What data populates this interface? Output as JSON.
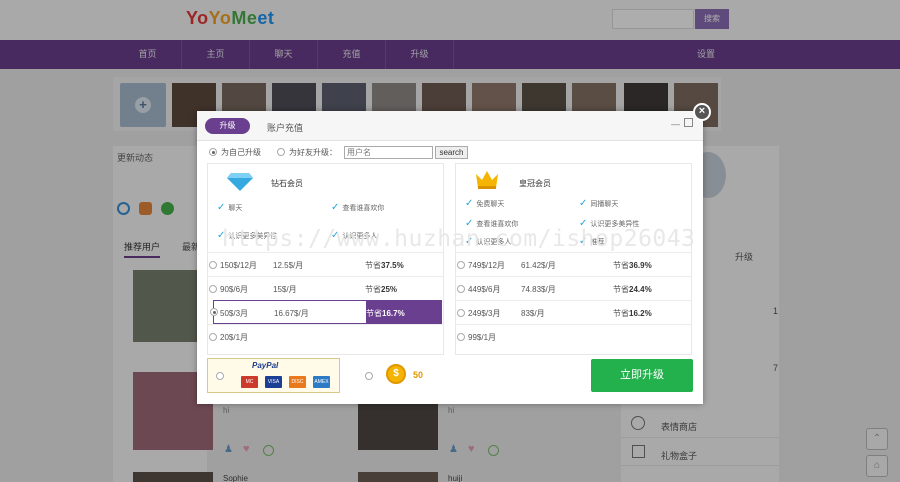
{
  "header": {
    "logo": {
      "p1": "Yo",
      "p2": "Yo",
      "p3": "Me",
      "p4": "et"
    },
    "search_button": "搜索"
  },
  "nav": {
    "items": [
      "首页",
      "主页",
      "聊天",
      "充值",
      "升级"
    ],
    "settings": "设置"
  },
  "feed": {
    "title": "更新动态"
  },
  "recommend_tabs": [
    "推荐用户",
    "最新"
  ],
  "cards": [
    {
      "text": "hi"
    },
    {
      "text": "hi"
    },
    {
      "name_partial": "Sophie"
    },
    {
      "name_partial": "huiji"
    }
  ],
  "right_sidebar": {
    "upgrade_label": "升级",
    "count_1": "1",
    "count_2": "7",
    "shop": "表情商店",
    "gift_box": "礼物盒子"
  },
  "modal": {
    "tabs": {
      "active": "升级",
      "inactive": "账户充值"
    },
    "options": {
      "self": "为自己升级",
      "friend": "为好友升级："
    },
    "username_placeholder": "用户名",
    "search_label": "search",
    "diamond": {
      "title": "钻石会员",
      "features": [
        "聊天",
        "查看谁喜欢你",
        "认识更多美异性",
        "认识更多人"
      ],
      "plans": [
        {
          "duration": "150$/12月",
          "monthly": "12.5$/月",
          "save_prefix": "节省",
          "save": "37.5%"
        },
        {
          "duration": "90$/6月",
          "monthly": "15$/月",
          "save_prefix": "节省",
          "save": "25%"
        },
        {
          "duration": "50$/3月",
          "monthly": "16.67$/月",
          "save_prefix": "节省",
          "save": "16.7%"
        },
        {
          "duration": "20$/1月",
          "monthly": "",
          "save_prefix": "",
          "save": ""
        }
      ]
    },
    "crown": {
      "title": "皇冠会员",
      "features": [
        "免费聊天",
        "同播聊天",
        "查看谁喜欢你",
        "认识更多美异性",
        "认识更多人",
        "推荐"
      ],
      "plans": [
        {
          "duration": "749$/12月",
          "monthly": "61.42$/月",
          "save_prefix": "节省",
          "save": "36.9%"
        },
        {
          "duration": "449$/6月",
          "monthly": "74.83$/月",
          "save_prefix": "节省",
          "save": "24.4%"
        },
        {
          "duration": "249$/3月",
          "monthly": "83$/月",
          "save_prefix": "节省",
          "save": "16.2%"
        },
        {
          "duration": "99$/1月",
          "monthly": "",
          "save_prefix": "",
          "save": ""
        }
      ]
    },
    "payment": {
      "paypal": "PayPal",
      "cards": [
        "MC",
        "VISA",
        "DISC",
        "AMEX"
      ],
      "coins": "50"
    },
    "upgrade_button": "立即升级"
  },
  "watermark": "https://www.huzhan.com/ishop26043",
  "colors": {
    "brand": "#6b3f8f",
    "upgrade": "#22b14c",
    "coin": "#f5b400",
    "check": "#2aa3d8"
  }
}
